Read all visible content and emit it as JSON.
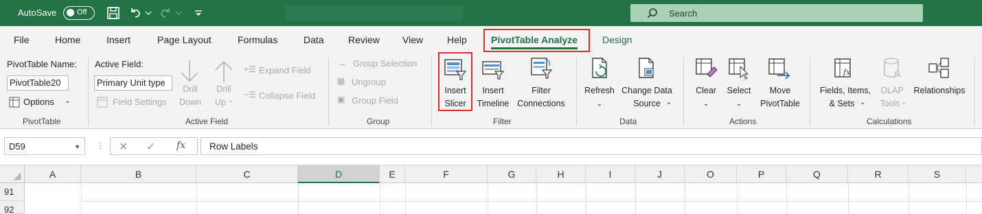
{
  "titlebar": {
    "autosave_label": "AutoSave",
    "autosave_state": "Off",
    "search_label": "Search"
  },
  "tabs": [
    {
      "label": "File"
    },
    {
      "label": "Home"
    },
    {
      "label": "Insert"
    },
    {
      "label": "Page Layout"
    },
    {
      "label": "Formulas"
    },
    {
      "label": "Data"
    },
    {
      "label": "Review"
    },
    {
      "label": "View"
    },
    {
      "label": "Help"
    },
    {
      "label": "PivotTable Analyze"
    },
    {
      "label": "Design"
    }
  ],
  "ribbon": {
    "pivottable": {
      "name_label": "PivotTable Name:",
      "name_value": "PivotTable20",
      "options_label": "Options",
      "group_label": "PivotTable"
    },
    "active_field": {
      "label": "Active Field:",
      "value": "Primary Unit type",
      "settings_label": "Field Settings",
      "drill_down_l1": "Drill",
      "drill_down_l2": "Down",
      "drill_up_l1": "Drill",
      "drill_up_l2": "Up",
      "expand_label": "Expand Field",
      "collapse_label": "Collapse Field",
      "group_label": "Active Field"
    },
    "group": {
      "selection_label": "Group Selection",
      "ungroup_label": "Ungroup",
      "field_label": "Group Field",
      "group_label": "Group"
    },
    "filter": {
      "insert_slicer_l1": "Insert",
      "insert_slicer_l2": "Slicer",
      "insert_timeline_l1": "Insert",
      "insert_timeline_l2": "Timeline",
      "filter_conn_l1": "Filter",
      "filter_conn_l2": "Connections",
      "group_label": "Filter"
    },
    "data": {
      "refresh_label": "Refresh",
      "change_source_l1": "Change Data",
      "change_source_l2": "Source",
      "group_label": "Data"
    },
    "actions": {
      "clear_label": "Clear",
      "select_label": "Select",
      "move_l1": "Move",
      "move_l2": "PivotTable",
      "group_label": "Actions"
    },
    "calculations": {
      "fields_l1": "Fields, Items,",
      "fields_l2": "& Sets",
      "olap_l1": "OLAP",
      "olap_l2": "Tools",
      "relationships_label": "Relationships",
      "group_label": "Calculations"
    }
  },
  "formula_bar": {
    "name_box": "D59",
    "fx": "fx",
    "formula": "Row Labels"
  },
  "grid": {
    "columns": [
      "A",
      "B",
      "C",
      "D",
      "E",
      "F",
      "G",
      "H",
      "I",
      "J",
      "O",
      "P",
      "Q",
      "R",
      "S"
    ],
    "selected_column": "D",
    "rows": [
      "91",
      "92"
    ]
  },
  "colors": {
    "accent": "#217346",
    "highlight_box": "#e02b2b"
  }
}
